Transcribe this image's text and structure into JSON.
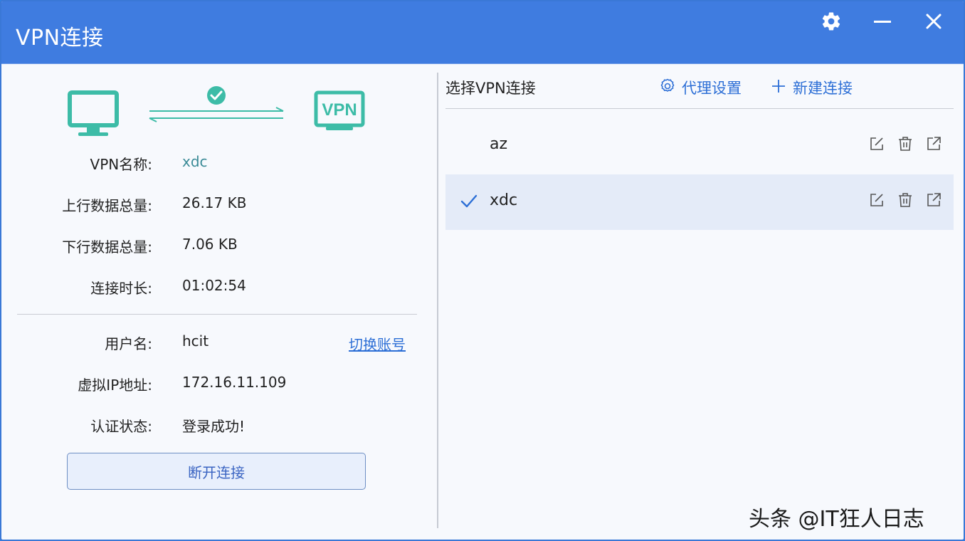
{
  "window": {
    "title": "VPN连接",
    "accent_color": "#3f7ce0"
  },
  "titlebar": {
    "settings_icon": "gear-icon",
    "minimize_icon": "minimize-icon",
    "close_icon": "close-icon"
  },
  "status_graphic": {
    "vpn_label": "VPN",
    "connected_color": "#3dbca7"
  },
  "info": {
    "vpn_name_label": "VPN名称:",
    "vpn_name_value": "xdc",
    "upload_label": "上行数据总量:",
    "upload_value": "26.17 KB",
    "download_label": "下行数据总量:",
    "download_value": "7.06 KB",
    "duration_label": "连接时长:",
    "duration_value": "01:02:54",
    "username_label": "用户名:",
    "username_value": "hcit",
    "switch_account_label": "切换账号",
    "virtual_ip_label": "虚拟IP地址:",
    "virtual_ip_value": "172.16.11.109",
    "auth_status_label": "认证状态:",
    "auth_status_value": "登录成功!"
  },
  "actions": {
    "disconnect_label": "断开连接"
  },
  "connections_panel": {
    "title": "选择VPN连接",
    "proxy_settings_label": "代理设置",
    "new_connection_label": "新建连接",
    "items": [
      {
        "name": "az",
        "selected": false
      },
      {
        "name": "xdc",
        "selected": true
      }
    ]
  },
  "watermark": {
    "text": "头条 @IT狂人日志"
  }
}
